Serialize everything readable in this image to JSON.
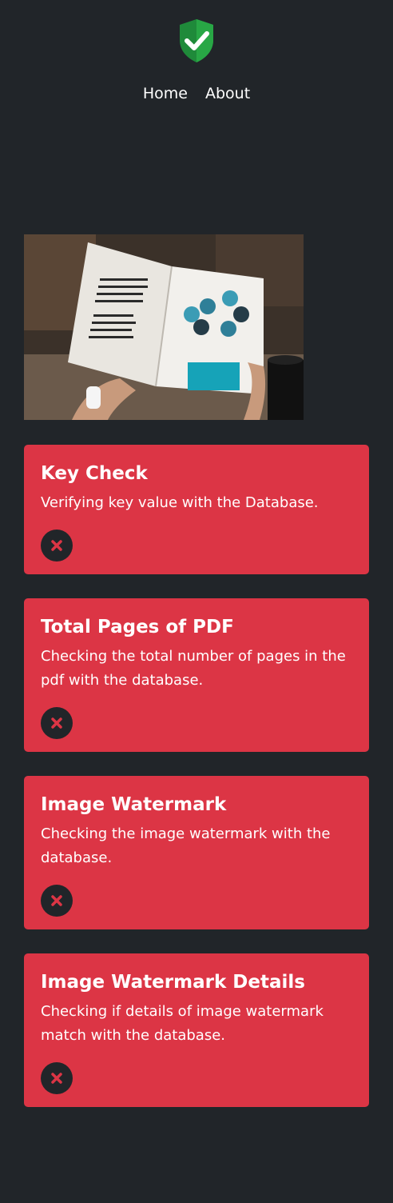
{
  "nav": {
    "home": "Home",
    "about": "About"
  },
  "icons": {
    "logo": "shield-check-icon",
    "status": "x-icon"
  },
  "colors": {
    "background": "#212529",
    "card": "#dc3545",
    "shield": "#28a745",
    "status_x": "#dc3545"
  },
  "checks": [
    {
      "title": "Key Check",
      "text": "Verifying key value with the Database.",
      "status": "failed"
    },
    {
      "title": "Total Pages of PDF",
      "text": "Checking the total number of pages in the pdf with the database.",
      "status": "failed"
    },
    {
      "title": "Image Watermark",
      "text": "Checking the image watermark with the database.",
      "status": "failed"
    },
    {
      "title": "Image Watermark Details",
      "text": "Checking if details of image watermark match with the database.",
      "status": "failed"
    }
  ]
}
